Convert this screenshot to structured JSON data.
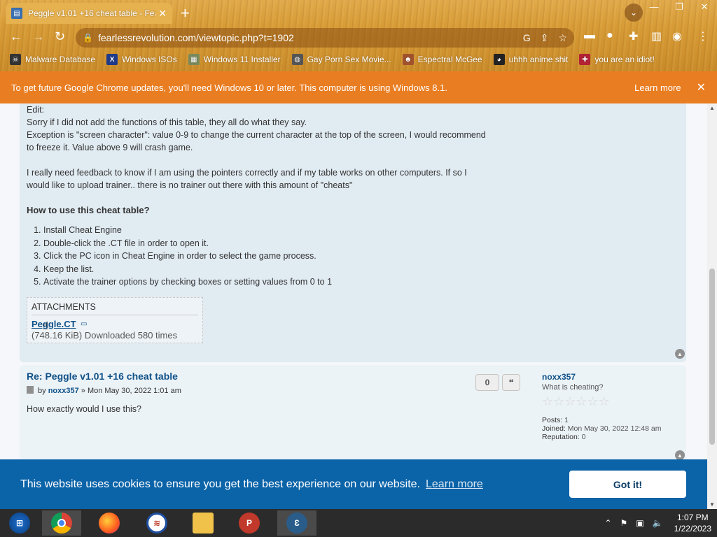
{
  "browser": {
    "tab_title": "Peggle v1.01 +16 cheat table - Fea",
    "url": "fearlessrevolution.com/viewtopic.php?t=1902",
    "bookmarks": [
      {
        "label": "Malware Database",
        "icon": "skull-icon"
      },
      {
        "label": "Windows ISOs",
        "icon": "x-logo-icon"
      },
      {
        "label": "Windows 11 Installer",
        "icon": "image-icon"
      },
      {
        "label": "Gay Porn Sex Movie...",
        "icon": "globe-icon"
      },
      {
        "label": "Espectral McGee",
        "icon": "avatar-icon"
      },
      {
        "label": "uhhh anime shit",
        "icon": "anime-icon"
      },
      {
        "label": "you are an idiot!",
        "icon": "flag-icon"
      }
    ]
  },
  "update_bar": {
    "message": "To get future Google Chrome updates, you'll need Windows 10 or later. This computer is using Windows 8.1.",
    "learn_more": "Learn more"
  },
  "post1": {
    "edit": "Edit:",
    "lines": [
      "Sorry if I did not add the functions of this table, they all do what they say.",
      "Exception is \"screen character\": value 0-9 to change the current character at the top of the screen, I would recommend",
      "to freeze it. Value above 9 will crash game.",
      "I really need feedback to know if I am using the pointers correctly and if my table works on other computers. If so I",
      "would like to upload trainer.. there is no trainer out there with this amount of \"cheats\""
    ],
    "howto_title": "How to use this cheat table?",
    "steps": [
      "Install Cheat Engine",
      "Double-click the .CT file in order to open it.",
      "Click the PC icon in Cheat Engine in order to select the game process.",
      "Keep the list.",
      "Activate the trainer options by checking boxes or setting values from 0 to 1"
    ],
    "attachments_header": "ATTACHMENTS",
    "attachment_file": "Peggle.CT",
    "attachment_meta": "(748.16 KiB) Downloaded 580 times"
  },
  "post2": {
    "title": "Re: Peggle v1.01 +16 cheat table",
    "by": "by",
    "author": "noxx357",
    "date": "» Mon May 30, 2022 1:01 am",
    "content": "How exactly would I use this?",
    "reaction_count": "0",
    "profile": {
      "username": "noxx357",
      "rank": "What is cheating?",
      "posts_label": "Posts:",
      "posts": "1",
      "joined_label": "Joined:",
      "joined": "Mon May 30, 2022 12:48 am",
      "reputation_label": "Reputation:",
      "reputation": "0"
    }
  },
  "cookie": {
    "message": "This website uses cookies to ensure you get the best experience on our website.",
    "learn_more": "Learn more",
    "button": "Got it!"
  },
  "taskbar": {
    "time": "1:07 PM",
    "date": "1/22/2023"
  },
  "colors": {
    "accent_link": "#105289",
    "update_bar": "#e97d21",
    "cookie_bar": "#0b63a8"
  }
}
